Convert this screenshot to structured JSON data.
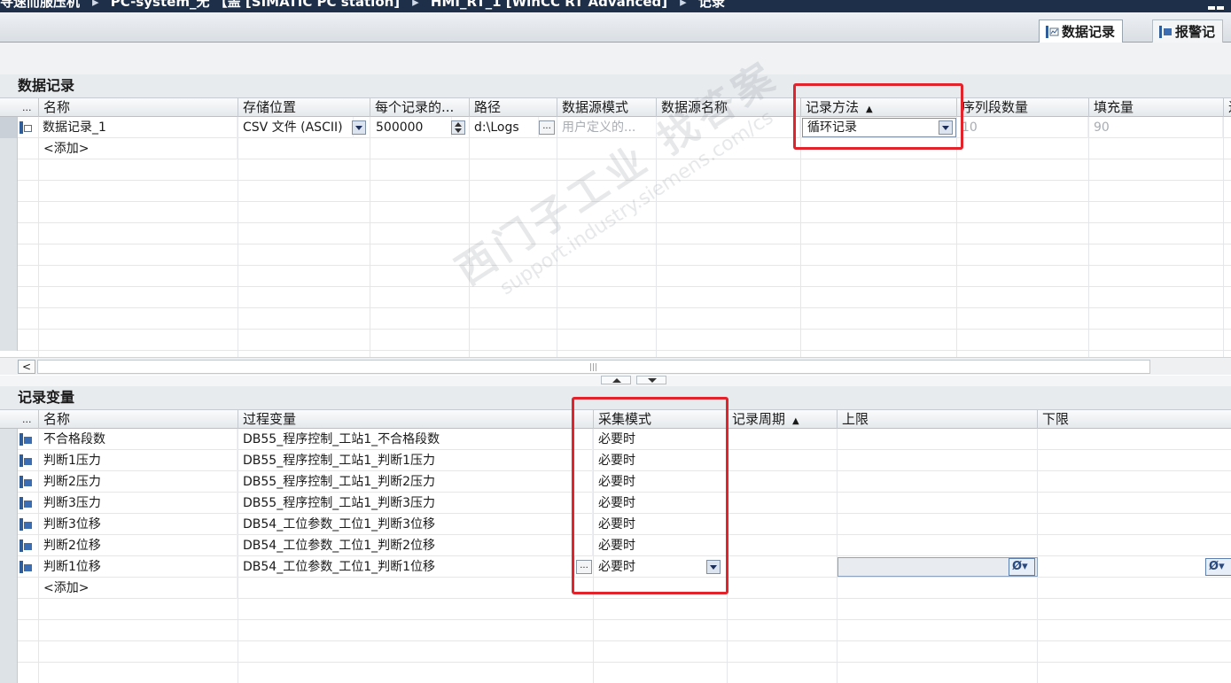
{
  "breadcrumb": [
    "寻速而服压机",
    "PC-system_无 【盖 [SIMATIC PC station]",
    "HMI_RT_1 [WinCC RT Advanced]",
    "记录"
  ],
  "tabs": [
    {
      "label": "数据记录",
      "active": true
    },
    {
      "label": "报警记",
      "active": false
    }
  ],
  "data_logs": {
    "title": "数据记录",
    "columns": {
      "dots": "...",
      "name": "名称",
      "storage": "存储位置",
      "per_record": "每个记录的...",
      "path": "路径",
      "source_mode": "数据源模式",
      "source_name": "数据源名称",
      "log_method": "记录方法",
      "segments": "序列段数量",
      "fill": "填充量",
      "more": "过"
    },
    "rows": [
      {
        "name": "数据记录_1",
        "storage": "CSV 文件 (ASCII)",
        "per_record": "500000",
        "path": "d:\\Logs",
        "source_mode": "用户定义的...",
        "source_name": "",
        "log_method": "循环记录",
        "segments": "10",
        "fill": "90"
      }
    ],
    "add_label": "<添加>"
  },
  "log_tags": {
    "title": "记录变量",
    "columns": {
      "dots": "...",
      "name": "名称",
      "process_tag": "过程变量",
      "acq_mode": "采集模式",
      "cycle": "记录周期",
      "upper": "上限",
      "lower": "下限"
    },
    "rows": [
      {
        "name": "不合格段数",
        "process_tag": "DB55_程序控制_工站1_不合格段数",
        "acq_mode": "必要时"
      },
      {
        "name": "判断1压力",
        "process_tag": "DB55_程序控制_工站1_判断1压力",
        "acq_mode": "必要时"
      },
      {
        "name": "判断2压力",
        "process_tag": "DB55_程序控制_工站1_判断2压力",
        "acq_mode": "必要时"
      },
      {
        "name": "判断3压力",
        "process_tag": "DB55_程序控制_工站1_判断3压力",
        "acq_mode": "必要时"
      },
      {
        "name": "判断3位移",
        "process_tag": "DB54_工位参数_工位1_判断3位移",
        "acq_mode": "必要时"
      },
      {
        "name": "判断2位移",
        "process_tag": "DB54_工位参数_工位1_判断2位移",
        "acq_mode": "必要时"
      },
      {
        "name": "判断1位移",
        "process_tag": "DB54_工位参数_工位1_判断1位移",
        "acq_mode": "必要时"
      }
    ],
    "add_label": "<添加>",
    "null_symbol": "Ø"
  },
  "scroll_thumb_glyph": "|||",
  "scroll_left_glyph": "<",
  "ellipsis_glyph": "...",
  "watermark": {
    "line1": "西门子工业 找答案",
    "line2": "support.industry.siemens.com/cs"
  },
  "colors": {
    "highlight_box": "#e3232b",
    "title_bar": "#1e2f4a",
    "icon_blue": "#2f5d9a"
  }
}
